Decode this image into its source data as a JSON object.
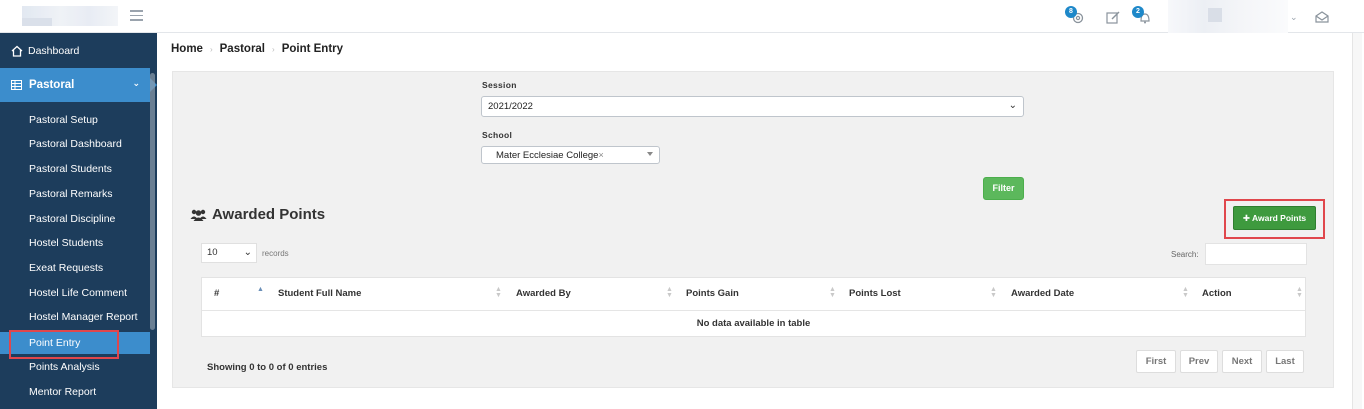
{
  "topbar": {
    "icons": [
      {
        "name": "gear-icon",
        "badge": "8"
      },
      {
        "name": "edit-icon",
        "badge": ""
      },
      {
        "name": "bell-icon",
        "badge": "2"
      },
      {
        "name": "envelope-open-icon",
        "badge": ""
      }
    ]
  },
  "sidebar": {
    "dashboard": "Dashboard",
    "pastoral": "Pastoral",
    "items": [
      "Pastoral Setup",
      "Pastoral Dashboard",
      "Pastoral Students",
      "Pastoral Remarks",
      "Pastoral Discipline",
      "Hostel Students",
      "Exeat Requests",
      "Hostel Life Comment",
      "Hostel Manager Report",
      "Point Entry",
      "Points Analysis",
      "Mentor Report"
    ],
    "active_item": "Point Entry"
  },
  "breadcrumb": [
    "Home",
    "Pastoral",
    "Point Entry"
  ],
  "filters": {
    "session_label": "Session",
    "session_value": "2021/2022",
    "school_label": "School",
    "school_value": "Mater Ecclesiae College",
    "school_clear": "×",
    "filter_button": "Filter"
  },
  "section": {
    "title": "Awarded Points",
    "award_button": "Award Points"
  },
  "table_controls": {
    "length_value": "10",
    "records_label": "records",
    "search_label": "Search:"
  },
  "table": {
    "columns": [
      "#",
      "Student Full Name",
      "Awarded By",
      "Points Gain",
      "Points Lost",
      "Awarded Date",
      "Action"
    ],
    "empty_message": "No data available in table"
  },
  "footer": {
    "info": "Showing 0 to 0 of 0 entries",
    "pagination": [
      "First",
      "Prev",
      "Next",
      "Last"
    ]
  },
  "colors": {
    "sidebar_bg": "#1d3d5c",
    "sidebar_active": "#3c8dcc",
    "filter_green": "#5cb85c",
    "award_green": "#3e9a3e",
    "highlight_red": "#e0474c"
  }
}
